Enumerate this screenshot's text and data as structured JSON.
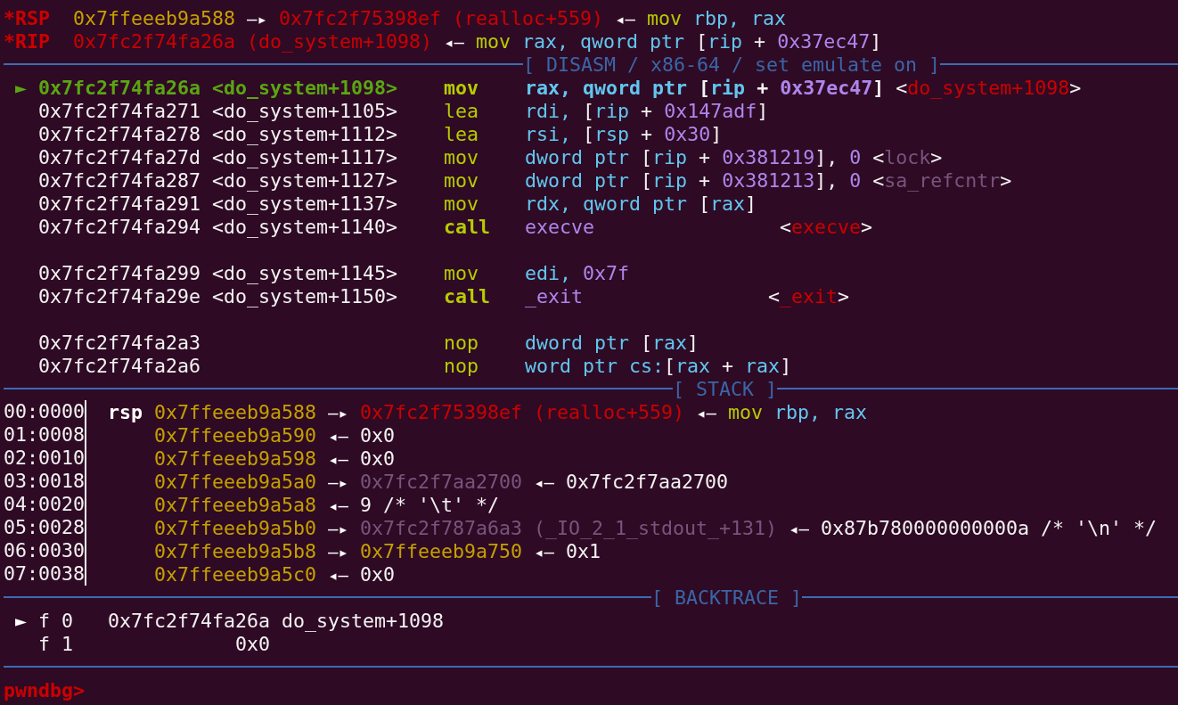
{
  "registers": [
    {
      "name": "*RSP",
      "chain": [
        {
          "text": "0x7ffeeeb9a588",
          "kind": "stack"
        },
        {
          "text": "—▸",
          "kind": "arrow"
        },
        {
          "text": "0x7fc2f75398ef",
          "kind": "code"
        },
        {
          "text": "(realloc+559)",
          "kind": "code"
        },
        {
          "text": "◂—",
          "kind": "arrow"
        },
        {
          "text": "mov",
          "kind": "mnemonic"
        },
        {
          "text": "rbp,",
          "kind": "reg"
        },
        {
          "text": "rax",
          "kind": "reg"
        }
      ]
    },
    {
      "name": "*RIP",
      "chain": [
        {
          "text": "0x7fc2f74fa26a",
          "kind": "code"
        },
        {
          "text": "(do_system+1098)",
          "kind": "code"
        },
        {
          "text": "◂—",
          "kind": "arrow"
        },
        {
          "text": "mov",
          "kind": "mnemonic"
        },
        {
          "text": "rax,",
          "kind": "reg"
        },
        {
          "text": "qword ptr",
          "kind": "reg"
        },
        {
          "text": "[",
          "kind": "punct"
        },
        {
          "text": "rip",
          "kind": "reg",
          "join": true
        },
        {
          "text": "+",
          "kind": "punct"
        },
        {
          "text": "0x37ec47",
          "kind": "num"
        },
        {
          "text": "]",
          "kind": "punct",
          "join": true
        }
      ]
    }
  ],
  "disasm": {
    "title": "[ DISASM / x86-64 / set emulate on ]",
    "groups": [
      {
        "rows": [
          {
            "marker": "►",
            "current": true,
            "kind": "plain",
            "address": "0x7fc2f74fa26a",
            "symbol": "<do_system+1098>",
            "mnemonic": "mov",
            "operands": [
              {
                "text": "rax,",
                "kind": "reg"
              },
              {
                "text": "qword ptr",
                "kind": "reg"
              },
              {
                "text": "[",
                "kind": "punct"
              },
              {
                "text": "rip",
                "kind": "reg",
                "join": true
              },
              {
                "text": "+",
                "kind": "punct"
              },
              {
                "text": "0x37ec47",
                "kind": "num"
              },
              {
                "text": "]",
                "kind": "punct",
                "join": true
              }
            ],
            "annotation": [
              {
                "text": "<",
                "kind": "punct"
              },
              {
                "text": "do_system+1098",
                "kind": "code",
                "join": true
              },
              {
                "text": ">",
                "kind": "punct",
                "join": true
              }
            ]
          },
          {
            "current": false,
            "kind": "plain",
            "address": "0x7fc2f74fa271",
            "symbol": "<do_system+1105>",
            "mnemonic": "lea",
            "operands": [
              {
                "text": "rdi,",
                "kind": "reg"
              },
              {
                "text": "[",
                "kind": "punct"
              },
              {
                "text": "rip",
                "kind": "reg",
                "join": true
              },
              {
                "text": "+",
                "kind": "punct"
              },
              {
                "text": "0x147adf",
                "kind": "num"
              },
              {
                "text": "]",
                "kind": "punct",
                "join": true
              }
            ]
          },
          {
            "current": false,
            "kind": "plain",
            "address": "0x7fc2f74fa278",
            "symbol": "<do_system+1112>",
            "mnemonic": "lea",
            "operands": [
              {
                "text": "rsi,",
                "kind": "reg"
              },
              {
                "text": "[",
                "kind": "punct"
              },
              {
                "text": "rsp",
                "kind": "reg",
                "join": true
              },
              {
                "text": "+",
                "kind": "punct"
              },
              {
                "text": "0x30",
                "kind": "num"
              },
              {
                "text": "]",
                "kind": "punct",
                "join": true
              }
            ]
          },
          {
            "current": false,
            "kind": "plain",
            "address": "0x7fc2f74fa27d",
            "symbol": "<do_system+1117>",
            "mnemonic": "mov",
            "operands": [
              {
                "text": "dword ptr",
                "kind": "reg"
              },
              {
                "text": "[",
                "kind": "punct"
              },
              {
                "text": "rip",
                "kind": "reg",
                "join": true
              },
              {
                "text": "+",
                "kind": "punct"
              },
              {
                "text": "0x381219",
                "kind": "num"
              },
              {
                "text": "],",
                "kind": "punct",
                "join": true
              },
              {
                "text": "0",
                "kind": "num"
              }
            ],
            "annotation": [
              {
                "text": "<",
                "kind": "punct"
              },
              {
                "text": "lock",
                "kind": "data",
                "join": true
              },
              {
                "text": ">",
                "kind": "punct",
                "join": true
              }
            ]
          },
          {
            "current": false,
            "kind": "plain",
            "address": "0x7fc2f74fa287",
            "symbol": "<do_system+1127>",
            "mnemonic": "mov",
            "operands": [
              {
                "text": "dword ptr",
                "kind": "reg"
              },
              {
                "text": "[",
                "kind": "punct"
              },
              {
                "text": "rip",
                "kind": "reg",
                "join": true
              },
              {
                "text": "+",
                "kind": "punct"
              },
              {
                "text": "0x381213",
                "kind": "num"
              },
              {
                "text": "],",
                "kind": "punct",
                "join": true
              },
              {
                "text": "0",
                "kind": "num"
              }
            ],
            "annotation": [
              {
                "text": "<",
                "kind": "punct"
              },
              {
                "text": "sa_refcntr",
                "kind": "data",
                "join": true
              },
              {
                "text": ">",
                "kind": "punct",
                "join": true
              }
            ]
          },
          {
            "current": false,
            "kind": "plain",
            "address": "0x7fc2f74fa291",
            "symbol": "<do_system+1137>",
            "mnemonic": "mov",
            "operands": [
              {
                "text": "rdx,",
                "kind": "reg"
              },
              {
                "text": "qword ptr",
                "kind": "reg"
              },
              {
                "text": "[",
                "kind": "punct"
              },
              {
                "text": "rax",
                "kind": "reg",
                "join": true
              },
              {
                "text": "]",
                "kind": "punct",
                "join": true
              }
            ]
          },
          {
            "current": false,
            "kind": "call",
            "address": "0x7fc2f74fa294",
            "symbol": "<do_system+1140>",
            "mnemonic": "call",
            "operands": [
              {
                "text": "execve",
                "kind": "num"
              }
            ],
            "annotation": [
              {
                "text": "<",
                "kind": "punct"
              },
              {
                "text": "execve",
                "kind": "code",
                "join": true
              },
              {
                "text": ">",
                "kind": "punct",
                "join": true
              }
            ]
          }
        ]
      },
      {
        "rows": [
          {
            "current": false,
            "kind": "plain",
            "address": "0x7fc2f74fa299",
            "symbol": "<do_system+1145>",
            "mnemonic": "mov",
            "operands": [
              {
                "text": "edi,",
                "kind": "reg"
              },
              {
                "text": "0x7f",
                "kind": "num"
              }
            ]
          },
          {
            "current": false,
            "kind": "call",
            "address": "0x7fc2f74fa29e",
            "symbol": "<do_system+1150>",
            "mnemonic": "call",
            "operands": [
              {
                "text": "_exit",
                "kind": "num"
              }
            ],
            "annotation": [
              {
                "text": "<",
                "kind": "punct"
              },
              {
                "text": "_exit",
                "kind": "code",
                "join": true
              },
              {
                "text": ">",
                "kind": "punct",
                "join": true
              }
            ]
          }
        ]
      },
      {
        "rows": [
          {
            "current": false,
            "kind": "plain",
            "address": "0x7fc2f74fa2a3",
            "mnemonic": "nop",
            "operands": [
              {
                "text": "dword ptr",
                "kind": "reg"
              },
              {
                "text": "[",
                "kind": "punct"
              },
              {
                "text": "rax",
                "kind": "reg",
                "join": true
              },
              {
                "text": "]",
                "kind": "punct",
                "join": true
              }
            ]
          },
          {
            "current": false,
            "kind": "plain",
            "address": "0x7fc2f74fa2a6",
            "mnemonic": "nop",
            "operands": [
              {
                "text": "word ptr cs:",
                "kind": "reg"
              },
              {
                "text": "[",
                "kind": "punct",
                "join": true
              },
              {
                "text": "rax",
                "kind": "reg",
                "join": true
              },
              {
                "text": "+",
                "kind": "punct"
              },
              {
                "text": "rax",
                "kind": "reg"
              },
              {
                "text": "]",
                "kind": "punct",
                "join": true
              }
            ]
          }
        ]
      }
    ]
  },
  "stack": {
    "title": "[ STACK ]",
    "rows": [
      {
        "offset": "00:0000",
        "register": "rsp",
        "chain": [
          {
            "text": "0x7ffeeeb9a588",
            "kind": "stack"
          },
          {
            "text": "—▸",
            "kind": "arrow"
          },
          {
            "text": "0x7fc2f75398ef",
            "kind": "code"
          },
          {
            "text": "(realloc+559)",
            "kind": "code"
          },
          {
            "text": "◂—",
            "kind": "arrow"
          },
          {
            "text": "mov",
            "kind": "mnemonic"
          },
          {
            "text": "rbp,",
            "kind": "reg"
          },
          {
            "text": "rax",
            "kind": "reg"
          }
        ]
      },
      {
        "offset": "01:0008",
        "chain": [
          {
            "text": "0x7ffeeeb9a590",
            "kind": "stack"
          },
          {
            "text": "◂—",
            "kind": "arrow"
          },
          {
            "text": "0x0",
            "kind": "plain"
          }
        ]
      },
      {
        "offset": "02:0010",
        "chain": [
          {
            "text": "0x7ffeeeb9a598",
            "kind": "stack"
          },
          {
            "text": "◂—",
            "kind": "arrow"
          },
          {
            "text": "0x0",
            "kind": "plain"
          }
        ]
      },
      {
        "offset": "03:0018",
        "chain": [
          {
            "text": "0x7ffeeeb9a5a0",
            "kind": "stack"
          },
          {
            "text": "—▸",
            "kind": "arrow"
          },
          {
            "text": "0x7fc2f7aa2700",
            "kind": "data"
          },
          {
            "text": "◂—",
            "kind": "arrow"
          },
          {
            "text": "0x7fc2f7aa2700",
            "kind": "plain"
          }
        ]
      },
      {
        "offset": "04:0020",
        "chain": [
          {
            "text": "0x7ffeeeb9a5a8",
            "kind": "stack"
          },
          {
            "text": "◂—",
            "kind": "arrow"
          },
          {
            "text": "9 /* '\\t' */",
            "kind": "plain"
          }
        ]
      },
      {
        "offset": "05:0028",
        "chain": [
          {
            "text": "0x7ffeeeb9a5b0",
            "kind": "stack"
          },
          {
            "text": "—▸",
            "kind": "arrow"
          },
          {
            "text": "0x7fc2f787a6a3",
            "kind": "data"
          },
          {
            "text": "(_IO_2_1_stdout_+131)",
            "kind": "data"
          },
          {
            "text": "◂—",
            "kind": "arrow"
          },
          {
            "text": "0x87b780000000000a /* '\\n' */",
            "kind": "plain"
          }
        ]
      },
      {
        "offset": "06:0030",
        "chain": [
          {
            "text": "0x7ffeeeb9a5b8",
            "kind": "stack"
          },
          {
            "text": "—▸",
            "kind": "arrow"
          },
          {
            "text": "0x7ffeeeb9a750",
            "kind": "stack"
          },
          {
            "text": "◂—",
            "kind": "arrow"
          },
          {
            "text": "0x1",
            "kind": "plain"
          }
        ]
      },
      {
        "offset": "07:0038",
        "chain": [
          {
            "text": "0x7ffeeeb9a5c0",
            "kind": "stack"
          },
          {
            "text": "◂—",
            "kind": "arrow"
          },
          {
            "text": "0x0",
            "kind": "plain"
          }
        ]
      }
    ]
  },
  "backtrace": {
    "title": "[ BACKTRACE ]",
    "frames": [
      {
        "marker": "►",
        "frame": "f 0",
        "address": "0x7fc2f74fa26a",
        "symbol": "do_system+1098"
      },
      {
        "frame": "f 1",
        "address": "0x0"
      }
    ]
  },
  "prompt": "pwndbg>"
}
